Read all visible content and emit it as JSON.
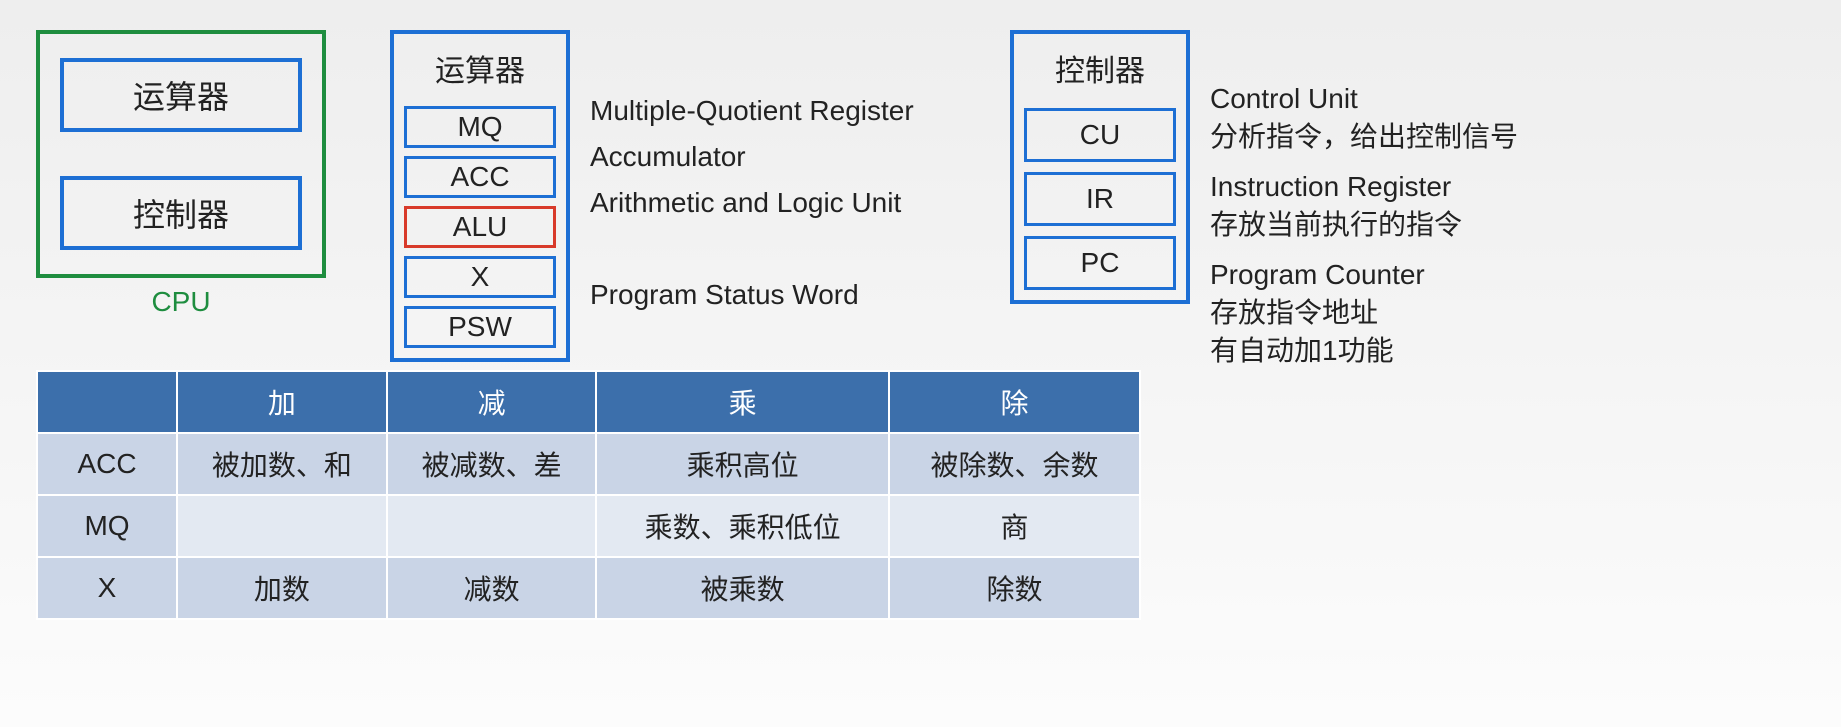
{
  "cpu": {
    "alu_label": "运算器",
    "cu_label": "控制器",
    "caption": "CPU"
  },
  "alu": {
    "title": "运算器",
    "regs": {
      "mq": "MQ",
      "acc": "ACC",
      "alu": "ALU",
      "x": "X",
      "psw": "PSW"
    },
    "desc": {
      "mq": "Multiple-Quotient Register",
      "acc": "Accumulator",
      "alu": "Arithmetic and Logic Unit",
      "x": "",
      "psw": "Program Status Word"
    }
  },
  "cu": {
    "title": "控制器",
    "regs": {
      "cu": "CU",
      "ir": "IR",
      "pc": "PC"
    },
    "desc": {
      "cu_en": "Control Unit",
      "cu_zh": "分析指令，给出控制信号",
      "ir_en": "Instruction Register",
      "ir_zh": "存放当前执行的指令",
      "pc_en": "Program Counter",
      "pc_zh1": "存放指令地址",
      "pc_zh2": "有自动加1功能"
    }
  },
  "table": {
    "headers": [
      "",
      "加",
      "减",
      "乘",
      "除"
    ],
    "rows": [
      {
        "name": "ACC",
        "cells": [
          "被加数、和",
          "被减数、差",
          "乘积高位",
          "被除数、余数"
        ]
      },
      {
        "name": "MQ",
        "cells": [
          "",
          "",
          "乘数、乘积低位",
          "商"
        ]
      },
      {
        "name": "X",
        "cells": [
          "加数",
          "减数",
          "被乘数",
          "除数"
        ]
      }
    ]
  }
}
